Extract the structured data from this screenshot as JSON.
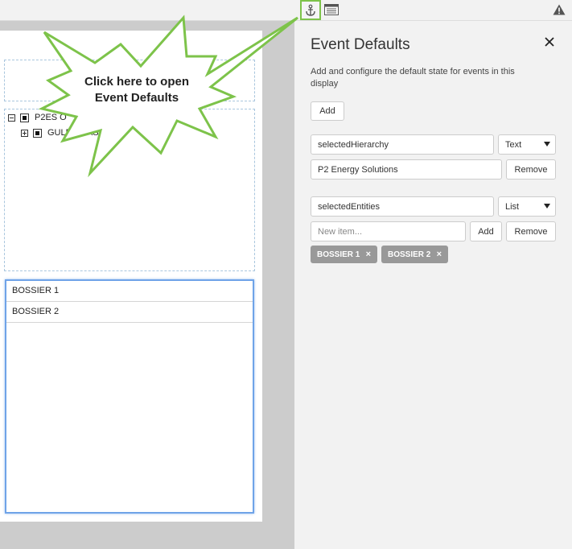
{
  "toolbar": {
    "icons": [
      "anchor-icon",
      "list-icon",
      "warning-icon"
    ]
  },
  "tree": {
    "root_label": "P2ES O",
    "child_label": "GULF COAST"
  },
  "list": {
    "items": [
      "BOSSIER 1",
      "BOSSIER 2"
    ]
  },
  "callout": {
    "line1": "Click here to open",
    "line2": "Event Defaults",
    "color": "#7dc34a"
  },
  "panel": {
    "title": "Event Defaults",
    "description": "Add and configure the default state for events in this display",
    "add_label": "Add",
    "events": [
      {
        "name": "selectedHierarchy",
        "type": "Text",
        "value": "P2 Energy Solutions",
        "remove_label": "Remove"
      },
      {
        "name": "selectedEntities",
        "type": "List",
        "new_item_placeholder": "New item...",
        "add_label": "Add",
        "remove_label": "Remove",
        "tags": [
          "BOSSIER 1",
          "BOSSIER 2"
        ]
      }
    ]
  }
}
